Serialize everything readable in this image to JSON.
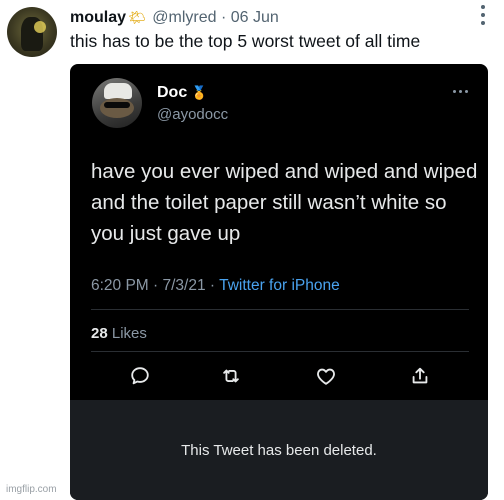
{
  "outer": {
    "name": "moulay",
    "name_emoji": "🌤",
    "handle": "@mlyred",
    "separator": "·",
    "date": "06 Jun",
    "text": "this has to be the top 5 worst tweet of all time"
  },
  "quoted": {
    "name": "Doc",
    "badge": "🏅",
    "handle": "@ayodocc",
    "text": "have you ever wiped and wiped and wiped and the toilet paper still wasn’t white so you just gave up",
    "time": "6:20 PM · 7/3/21 ·",
    "source": "Twitter for iPhone",
    "likes_count": "28",
    "likes_label": "Likes",
    "deleted_notice": "This Tweet has been deleted."
  },
  "watermark": "imgflip.com",
  "icons": [
    "reply-icon",
    "retweet-icon",
    "like-icon",
    "share-icon",
    "more-icon"
  ],
  "colors": {
    "link": "#4aa3ef",
    "embed_bg": "#000000",
    "deleted_bg": "#1a1d21"
  }
}
